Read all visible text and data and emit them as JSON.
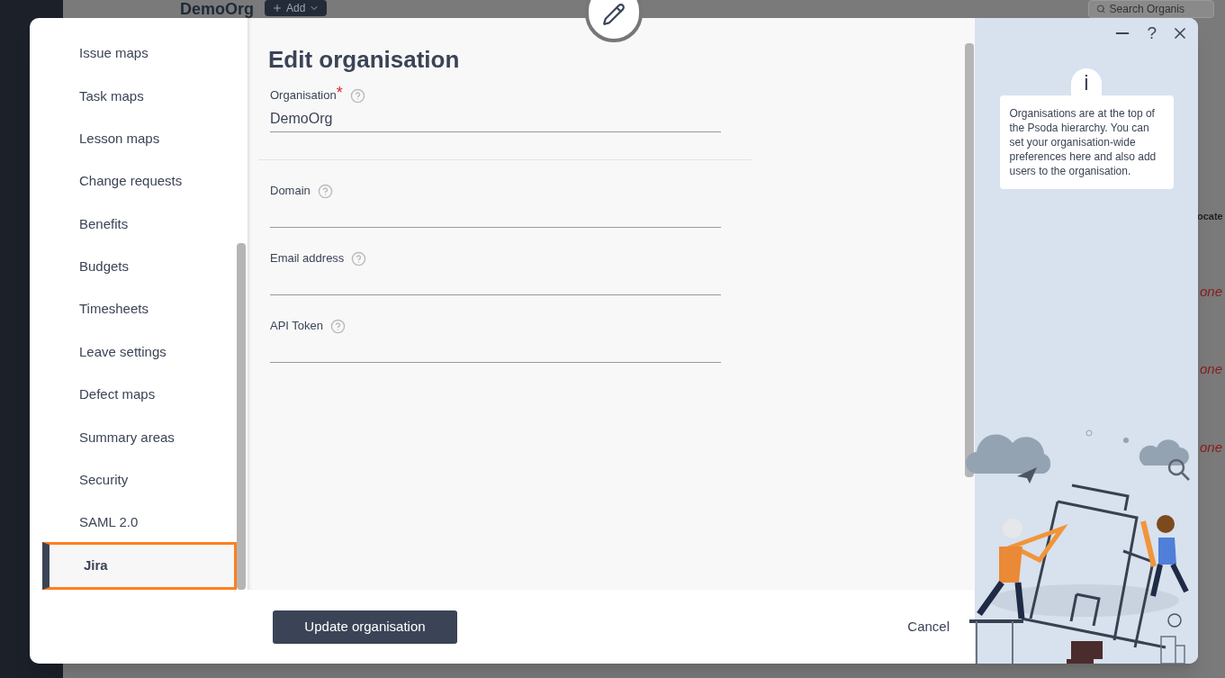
{
  "background": {
    "org_title": "DemoOrg",
    "add_button": "Add",
    "search": {
      "placeholder": "Search Organis"
    },
    "edge_texts": [
      "ocate",
      "one",
      "one",
      "one"
    ]
  },
  "dialog": {
    "title": "Edit organisation",
    "nav_items": [
      {
        "label": "Issue maps",
        "selected": false
      },
      {
        "label": "Task maps",
        "selected": false
      },
      {
        "label": "Lesson maps",
        "selected": false
      },
      {
        "label": "Change requests",
        "selected": false
      },
      {
        "label": "Benefits",
        "selected": false
      },
      {
        "label": "Budgets",
        "selected": false
      },
      {
        "label": "Timesheets",
        "selected": false
      },
      {
        "label": "Leave settings",
        "selected": false
      },
      {
        "label": "Defect maps",
        "selected": false
      },
      {
        "label": "Summary areas",
        "selected": false
      },
      {
        "label": "Security",
        "selected": false
      },
      {
        "label": "SAML 2.0",
        "selected": false
      },
      {
        "label": "Jira",
        "selected": true
      }
    ],
    "required_mark": "*",
    "fields": [
      {
        "label": "Organisation",
        "required": true,
        "value": "DemoOrg"
      },
      {
        "label": "Domain",
        "required": false
      },
      {
        "label": "Email address",
        "required": false
      },
      {
        "label": "API Token",
        "required": false
      }
    ],
    "primary_button": "Update organisation",
    "cancel_button": "Cancel",
    "help_button": "?",
    "info_mark": "i",
    "info_text": "Organisations are at the top of the Psoda hierarchy. You can set your organisation-wide preferences here and also add users to the organisation."
  }
}
